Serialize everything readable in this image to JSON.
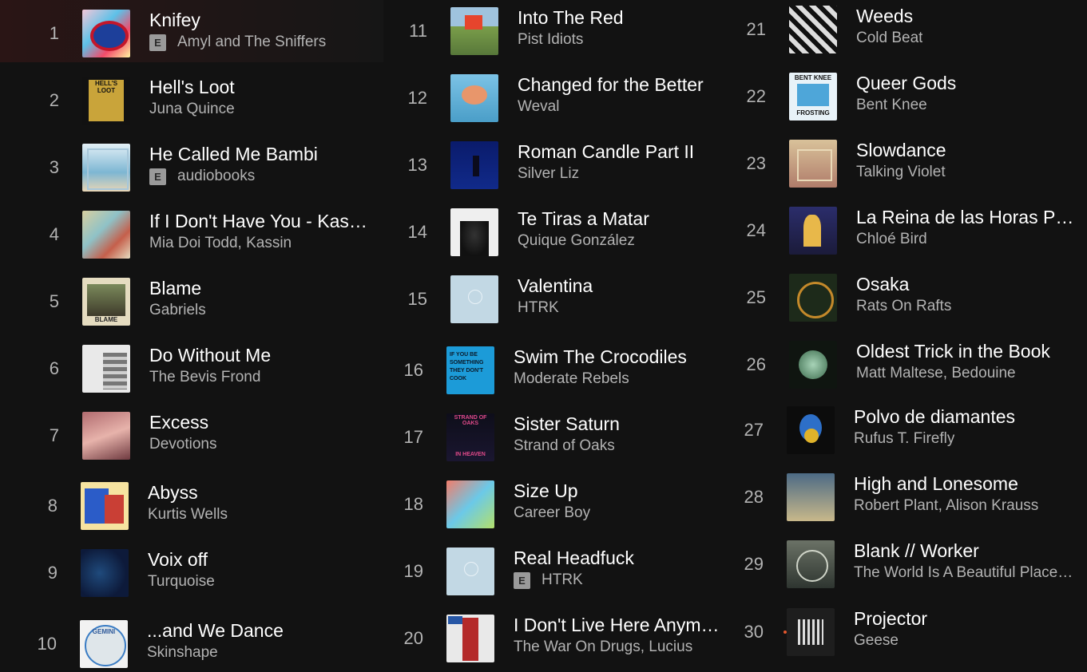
{
  "tracks": [
    {
      "num": "1",
      "title": "Knifey",
      "artist": "Amyl and The Sniffers",
      "explicit": true,
      "cover": "knifey"
    },
    {
      "num": "2",
      "title": "Hell's Loot",
      "artist": "Juna Quince",
      "explicit": false,
      "cover": "hells"
    },
    {
      "num": "3",
      "title": "He Called Me Bambi",
      "artist": "audiobooks",
      "explicit": true,
      "cover": "bambi"
    },
    {
      "num": "4",
      "title": "If I Don't Have You - Kassin Remix",
      "artist": "Mia Doi Todd, Kassin",
      "explicit": false,
      "cover": "mia"
    },
    {
      "num": "5",
      "title": "Blame",
      "artist": "Gabriels",
      "explicit": false,
      "cover": "blame"
    },
    {
      "num": "6",
      "title": "Do Without Me",
      "artist": "The Bevis Frond",
      "explicit": false,
      "cover": "bevis"
    },
    {
      "num": "7",
      "title": "Excess",
      "artist": "Devotions",
      "explicit": false,
      "cover": "excess"
    },
    {
      "num": "8",
      "title": "Abyss",
      "artist": "Kurtis Wells",
      "explicit": false,
      "cover": "abyss"
    },
    {
      "num": "9",
      "title": "Voix off",
      "artist": "Turquoise",
      "explicit": false,
      "cover": "voix"
    },
    {
      "num": "10",
      "title": "...and We Dance",
      "artist": "Skinshape",
      "explicit": false,
      "cover": "dance"
    },
    {
      "num": "11",
      "title": "Into The Red",
      "artist": "Pist Idiots",
      "explicit": false,
      "cover": "red"
    },
    {
      "num": "12",
      "title": "Changed for the Better",
      "artist": "Weval",
      "explicit": false,
      "cover": "weval"
    },
    {
      "num": "13",
      "title": "Roman Candle Part II",
      "artist": "Silver Liz",
      "explicit": false,
      "cover": "roman"
    },
    {
      "num": "14",
      "title": "Te Tiras a Matar",
      "artist": "Quique González",
      "explicit": false,
      "cover": "tiras"
    },
    {
      "num": "15",
      "title": "Valentina",
      "artist": "HTRK",
      "explicit": false,
      "cover": "htrk"
    },
    {
      "num": "16",
      "title": "Swim The Crocodiles",
      "artist": "Moderate Rebels",
      "explicit": false,
      "cover": "swim"
    },
    {
      "num": "17",
      "title": "Sister Saturn",
      "artist": "Strand of Oaks",
      "explicit": false,
      "cover": "saturn"
    },
    {
      "num": "18",
      "title": "Size Up",
      "artist": "Career Boy",
      "explicit": false,
      "cover": "size"
    },
    {
      "num": "19",
      "title": "Real Headfuck",
      "artist": "HTRK",
      "explicit": true,
      "cover": "htrk"
    },
    {
      "num": "20",
      "title": "I Don't Live Here Anymore",
      "artist": "The War On Drugs, Lucius",
      "explicit": false,
      "cover": "wod"
    },
    {
      "num": "21",
      "title": "Weeds",
      "artist": "Cold Beat",
      "explicit": false,
      "cover": "weeds"
    },
    {
      "num": "22",
      "title": "Queer Gods",
      "artist": "Bent Knee",
      "explicit": false,
      "cover": "bent"
    },
    {
      "num": "23",
      "title": "Slowdance",
      "artist": "Talking Violet",
      "explicit": false,
      "cover": "slow"
    },
    {
      "num": "24",
      "title": "La Reina de las Horas Perdidas",
      "artist": "Chloé Bird",
      "explicit": false,
      "cover": "reina"
    },
    {
      "num": "25",
      "title": "Osaka",
      "artist": "Rats On Rafts",
      "explicit": false,
      "cover": "osaka"
    },
    {
      "num": "26",
      "title": "Oldest Trick in the Book",
      "artist": "Matt Maltese, Bedouine",
      "explicit": false,
      "cover": "oldest"
    },
    {
      "num": "27",
      "title": "Polvo de diamantes",
      "artist": "Rufus T. Firefly",
      "explicit": false,
      "cover": "polvo"
    },
    {
      "num": "28",
      "title": "High and Lonesome",
      "artist": "Robert Plant, Alison Krauss",
      "explicit": false,
      "cover": "high"
    },
    {
      "num": "29",
      "title": "Blank // Worker",
      "artist": "The World Is A Beautiful Place & I Am No Longer Afraid To Die",
      "explicit": false,
      "cover": "blank"
    },
    {
      "num": "30",
      "title": "Projector",
      "artist": "Geese",
      "explicit": false,
      "cover": "proj"
    }
  ],
  "explicit_label": "E",
  "cover_texts": {
    "hells": "HELL'S LOOT",
    "bent": "BENT KNEE",
    "bent2": "FROSTING",
    "saturn": "STRAND OF OAKS",
    "saturn2": "IN HEAVEN",
    "blame": "BLAME",
    "dance": "GEMINI",
    "swim": "IF YOU BE SOMETHING THEY DON'T COOK"
  }
}
